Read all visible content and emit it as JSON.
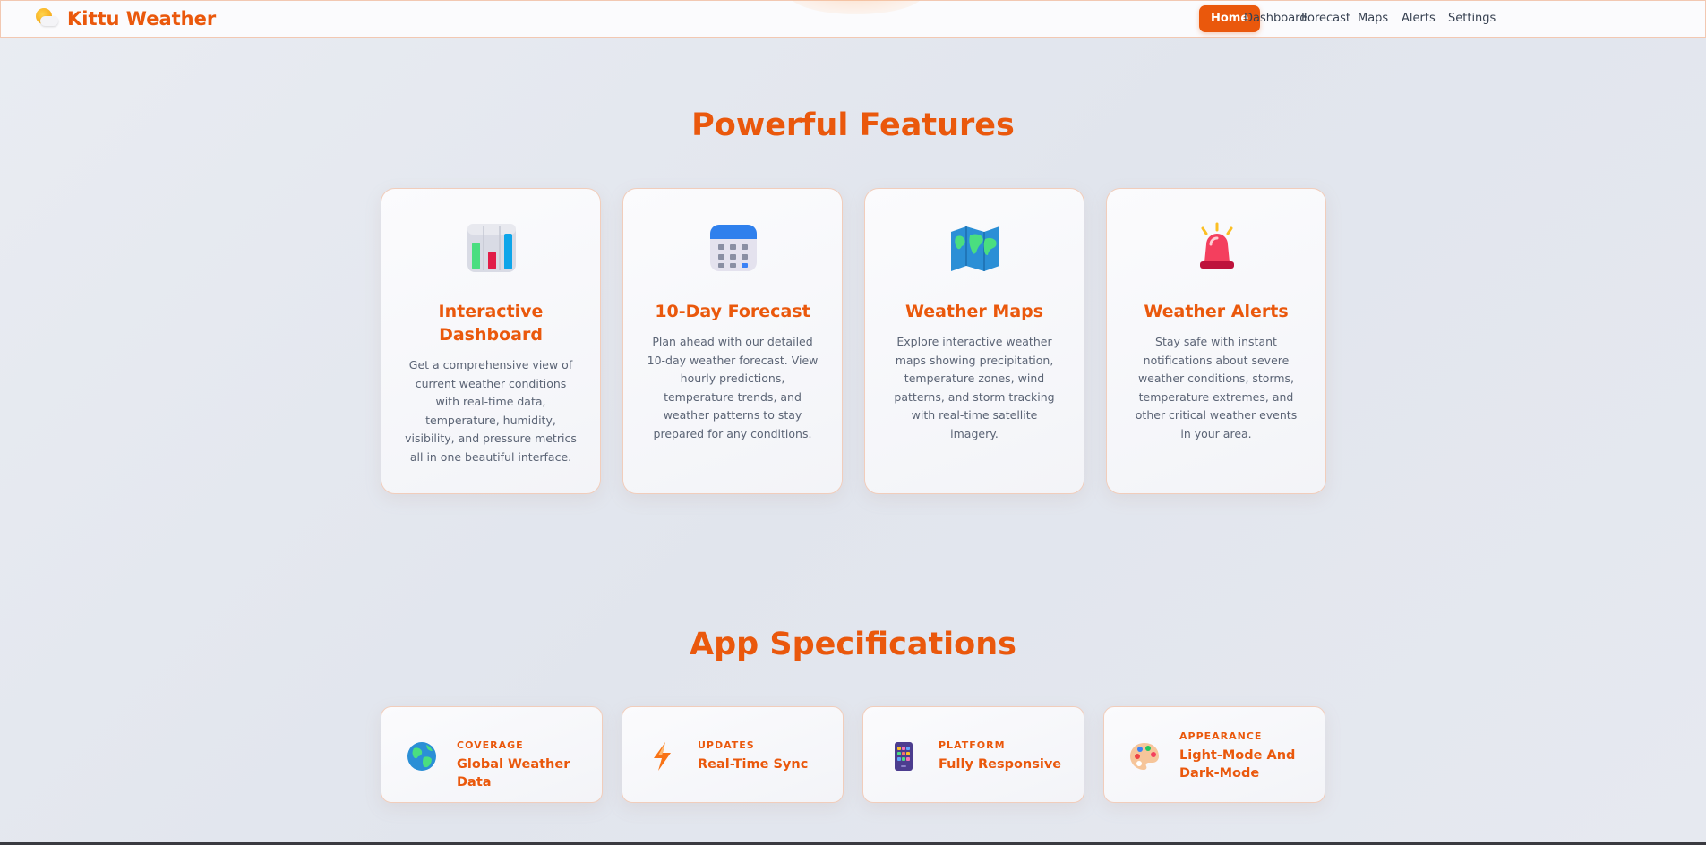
{
  "brand": {
    "name": "Kittu Weather",
    "icon": "sun-cloud-icon"
  },
  "nav": {
    "items": [
      {
        "label": "Home",
        "active": true
      },
      {
        "label": "Dashboard",
        "active": false
      },
      {
        "label": "Forecast",
        "active": false
      },
      {
        "label": "Maps",
        "active": false
      },
      {
        "label": "Alerts",
        "active": false
      },
      {
        "label": "Settings",
        "active": false
      }
    ]
  },
  "features": {
    "title": "Powerful Features",
    "cards": [
      {
        "icon": "bar-chart-icon",
        "title": "Interactive Dashboard",
        "description": "Get a comprehensive view of current weather conditions with real-time data, temperature, humidity, visibility, and pressure metrics all in one beautiful interface."
      },
      {
        "icon": "calendar-icon",
        "title": "10-Day Forecast",
        "description": "Plan ahead with our detailed 10-day weather forecast. View hourly predictions, temperature trends, and weather patterns to stay prepared for any conditions."
      },
      {
        "icon": "world-map-icon",
        "title": "Weather Maps",
        "description": "Explore interactive weather maps showing precipitation, temperature zones, wind patterns, and storm tracking with real-time satellite imagery."
      },
      {
        "icon": "siren-icon",
        "title": "Weather Alerts",
        "description": "Stay safe with instant notifications about severe weather conditions, storms, temperature extremes, and other critical weather events in your area."
      }
    ]
  },
  "specs": {
    "title": "App Specifications",
    "cards": [
      {
        "icon": "globe-icon",
        "label": "COVERAGE",
        "value": "Global Weather Data"
      },
      {
        "icon": "lightning-icon",
        "label": "UPDATES",
        "value": "Real-Time Sync"
      },
      {
        "icon": "mobile-phone-icon",
        "label": "PLATFORM",
        "value": "Fully Responsive"
      },
      {
        "icon": "palette-icon",
        "label": "APPEARANCE",
        "value": "Light-Mode And Dark-Mode"
      }
    ]
  },
  "colors": {
    "accent": "#ea580c",
    "background": "#e4e7ee",
    "card_border": "#f1cdbb"
  }
}
